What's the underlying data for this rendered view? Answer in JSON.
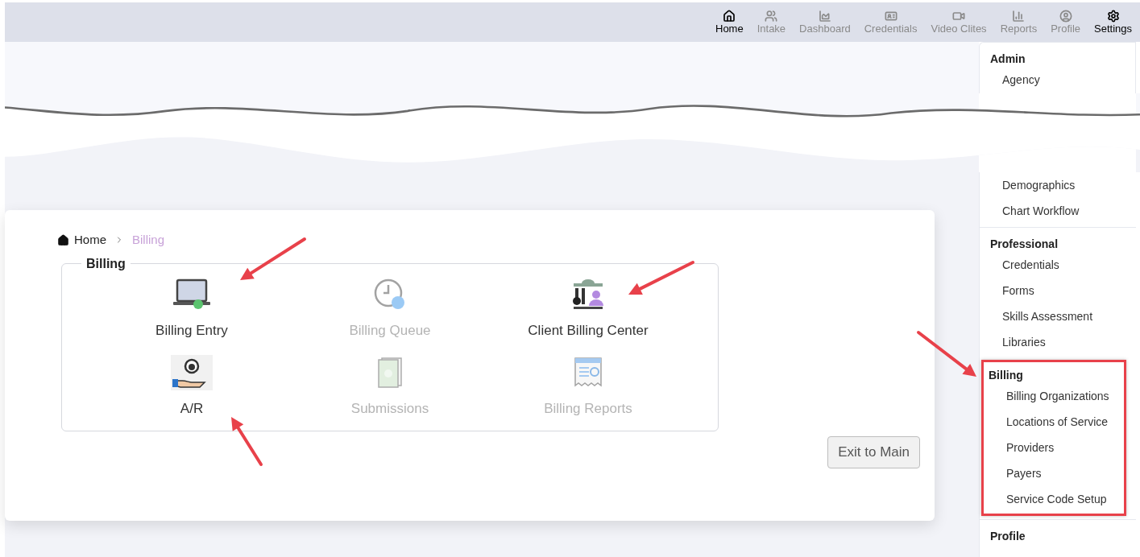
{
  "top_nav": [
    {
      "label": "Home",
      "active": true
    },
    {
      "label": "Intake",
      "active": false
    },
    {
      "label": "Dashboard",
      "active": false
    },
    {
      "label": "Credentials",
      "active": false
    },
    {
      "label": "Video Clites",
      "active": false
    },
    {
      "label": "Reports",
      "active": false
    },
    {
      "label": "Profile",
      "active": false
    },
    {
      "label": "Settings",
      "active": true
    }
  ],
  "settings_menu": {
    "first_section": {
      "title": "Admin",
      "items": [
        "Agency"
      ]
    },
    "after_cut_items": [
      "Demographics",
      "Chart Workflow"
    ],
    "sections": [
      {
        "title": "Professional",
        "highlighted": false,
        "items": [
          "Credentials",
          "Forms",
          "Skills Assessment",
          "Libraries"
        ]
      },
      {
        "title": "Billing",
        "highlighted": true,
        "items": [
          "Billing Organizations",
          "Locations of Service",
          "Providers",
          "Payers",
          "Service Code Setup"
        ]
      },
      {
        "title": "Profile",
        "highlighted": false
      }
    ]
  },
  "breadcrumb": [
    {
      "label": "Home",
      "current": false
    },
    {
      "label": "Billing",
      "current": true
    }
  ],
  "billing_group": {
    "title": "Billing",
    "tiles": [
      {
        "label": "Billing Entry",
        "disabled": false
      },
      {
        "label": "Billing Queue",
        "disabled": true
      },
      {
        "label": "Client Billing Center",
        "disabled": false
      },
      {
        "label": "A/R",
        "disabled": false
      },
      {
        "label": "Submissions",
        "disabled": true
      },
      {
        "label": "Billing Reports",
        "disabled": true
      }
    ]
  },
  "exit_button": "Exit to Main"
}
